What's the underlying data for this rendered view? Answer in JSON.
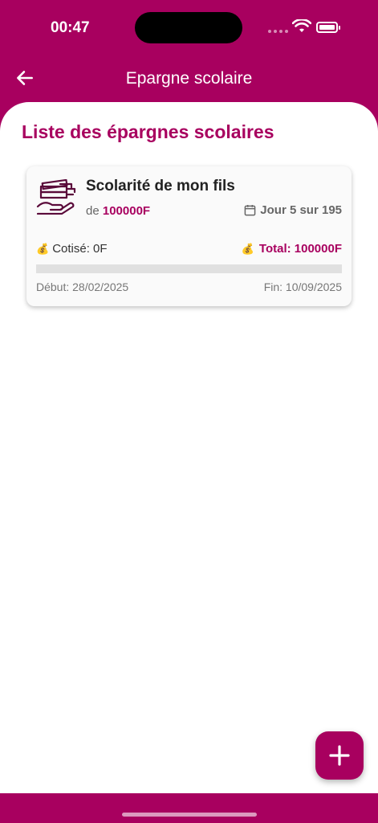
{
  "status": {
    "time": "00:47"
  },
  "header": {
    "title": "Epargne scolaire"
  },
  "section": {
    "title": "Liste des épargnes scolaires"
  },
  "saving": {
    "title": "Scolarité de mon fils",
    "amount_prefix": "de",
    "amount": "100000F",
    "day_progress": "Jour 5 sur 195",
    "contributed": "Cotisé: 0F",
    "total": "Total: 100000F",
    "progress_fraction": 0,
    "start": "Début: 28/02/2025",
    "end": "Fin: 10/09/2025"
  },
  "colors": {
    "primary": "#A8005F",
    "icon": "#5a0a3a"
  },
  "icons": {
    "back": "arrow-left-icon",
    "add": "plus-icon",
    "calendar": "calendar-icon",
    "money": "money-bag-icon",
    "savings": "money-hand-icon"
  }
}
